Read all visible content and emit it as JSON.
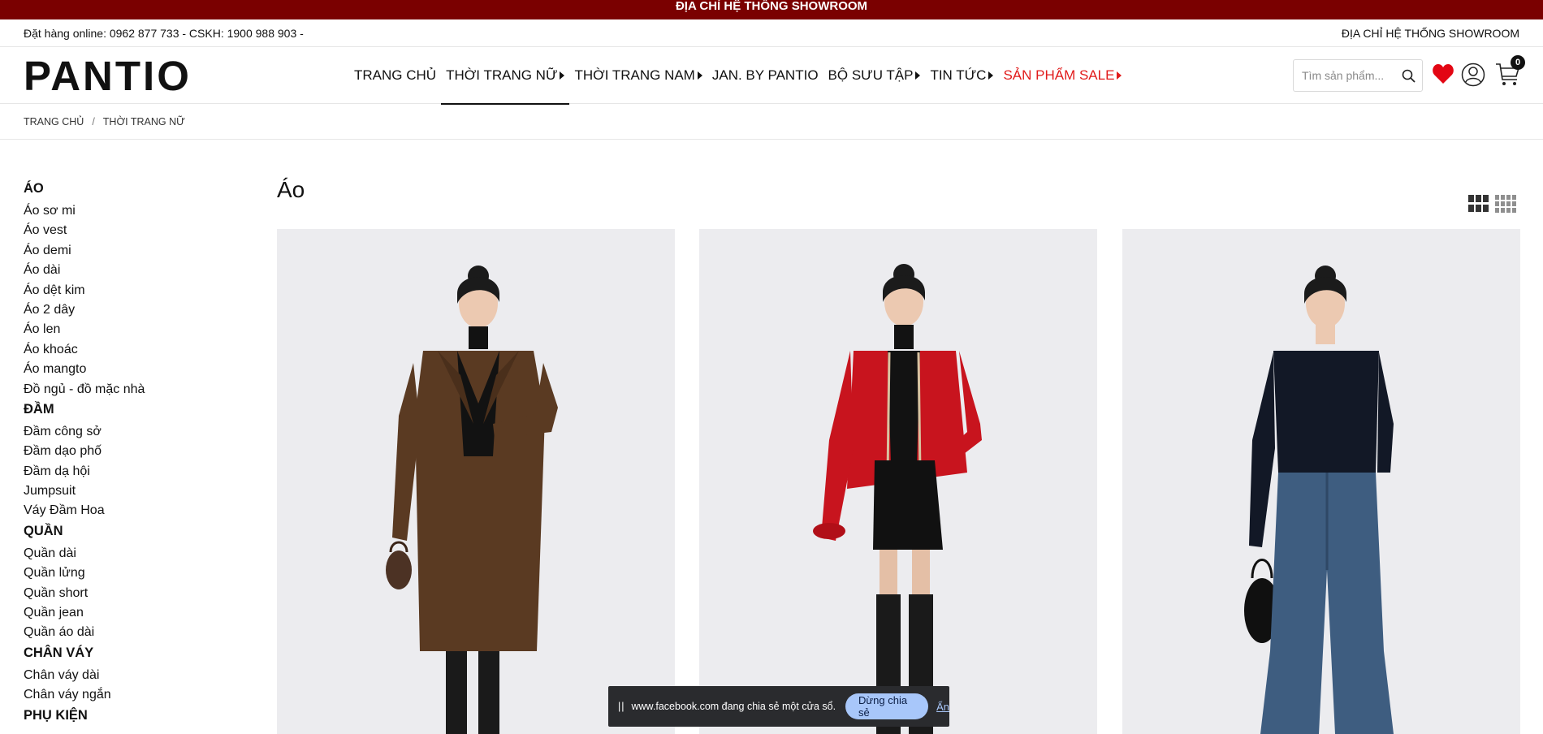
{
  "topbar": {
    "text": "ĐỊA CHỈ HỆ THỐNG SHOWROOM"
  },
  "infobar": {
    "contact": "Đặt hàng online: 0962 877 733 - CSKH: 1900 988 903 -",
    "showroom": "ĐỊA CHỈ HỆ THỐNG SHOWROOM"
  },
  "header": {
    "logo": "PANTIO",
    "nav": [
      {
        "label": "TRANG CHỦ",
        "caret": false
      },
      {
        "label": "THỜI TRANG NỮ",
        "caret": true
      },
      {
        "label": "THỜI TRANG NAM",
        "caret": true
      },
      {
        "label": "JAN. BY PANTIO",
        "caret": false
      },
      {
        "label": "BỘ SƯU TẬP",
        "caret": true
      },
      {
        "label": "TIN TỨC",
        "caret": true
      },
      {
        "label": "SẢN PHẨM SALE",
        "caret": true
      }
    ],
    "active_nav": "THỜI TRANG NỮ",
    "sale_color": "#e11b1b",
    "search_placeholder": "Tìm sản phẩm...",
    "cart_count": "0",
    "icons": [
      "search-icon",
      "heart-icon",
      "user-icon",
      "cart-icon"
    ],
    "heart_color": "#e30613"
  },
  "breadcrumb": {
    "home": "TRANG CHỦ",
    "sep": "/",
    "current": "THỜI TRANG NỮ"
  },
  "sidebar": {
    "groups": [
      {
        "title": "ÁO",
        "items": [
          "Áo sơ mi",
          "Áo vest",
          "Áo demi",
          "Áo dài",
          "Áo dệt kim",
          "Áo 2 dây",
          "Áo len",
          "Áo khoác",
          "Áo mangto",
          "Đồ ngủ - đồ mặc nhà"
        ]
      },
      {
        "title": "ĐẦM",
        "items": [
          "Đầm công sở",
          "Đầm dạo phố",
          "Đầm dạ hội",
          "Jumpsuit",
          "Váy Đầm Hoa"
        ]
      },
      {
        "title": "QUẦN",
        "items": [
          "Quần dài",
          "Quần lửng",
          "Quần short",
          "Quần jean",
          "Quần áo dài"
        ]
      },
      {
        "title": "CHÂN VÁY",
        "items": [
          "Chân váy dài",
          "Chân váy ngắn"
        ]
      },
      {
        "title": "PHỤ KIỆN",
        "items": []
      }
    ]
  },
  "main": {
    "title": "Áo",
    "view_icons": [
      "grid-3-icon",
      "grid-4-icon"
    ]
  },
  "products": [
    {
      "name": "brown-coat-photo",
      "accent": "#5a3a22"
    },
    {
      "name": "red-cardigan-photo",
      "accent": "#c8141e"
    },
    {
      "name": "black-top-jeans-photo",
      "accent": "#3e5d80"
    }
  ],
  "share_bar": {
    "text": "www.facebook.com đang chia sẻ một cửa sổ.",
    "stop_label": "Dừng chia sẻ",
    "hide_label": "Ẩn"
  },
  "colors": {
    "topbar_bg": "#7a0000"
  }
}
